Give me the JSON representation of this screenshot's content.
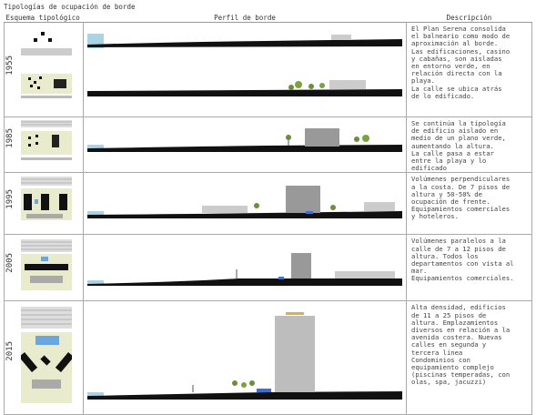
{
  "title": "Tipologías de ocupación de borde",
  "headers": {
    "scheme": "Esquema tipológico",
    "profile": "Perfil de borde",
    "description": "Descripción"
  },
  "rows": [
    {
      "year": "1955",
      "description": "El Plan Serena consolida\nel balneario como modo de\naproximación al borde.\nLas edificaciones, casino\ny cabañas, son aisladas\nen entorno verde, en\nrelación directa con la\nplaya.\nLa calle se ubica atrás\nde lo edificado."
    },
    {
      "year": "1985",
      "description": "Se continúa la tipología\nde edificio aislado en\nmedio de un plano verde,\naumentando la altura.\nLa calle pasa a estar\nentre la playa y lo\nedificado"
    },
    {
      "year": "1995",
      "description": "Volúmenes perpendiculares\na la costa. De 7 pisos de\naltura y 50-50% de\nocupación de frente.\nEquipamientos comerciales\ny hoteleros."
    },
    {
      "year": "2005",
      "description": "Volúmenes paralelos a la\ncalle de 7 a 12 pisos de\naltura. Todos los\ndepartamentos con vista al\nmar.\nEquipamientos comerciales."
    },
    {
      "year": "2015",
      "description": "Alta densidad, edificios\nde 11 a 25 pisos de\naltura. Emplazamientos\ndiversos en relación a la\navenida costera. Nuevas\ncalles en segunda y\ntercera línea\nCondominios con\nequipamiento complejo\n(piscinas temperadas, con\nolas, spa, jacuzzi)"
    }
  ]
}
